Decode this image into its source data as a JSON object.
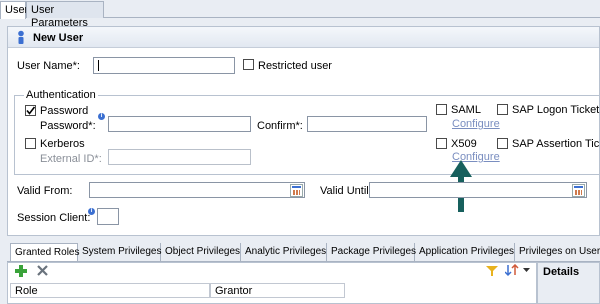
{
  "tabs": [
    {
      "label": "User"
    },
    {
      "label": "User Parameters"
    }
  ],
  "header": {
    "title": "New User"
  },
  "form": {
    "user_name_label": "User Name*:",
    "user_name_value": "",
    "restricted_user_label": "Restricted user",
    "authentication_label": "Authentication",
    "password_label": "Password",
    "password_field_label": "Password*:",
    "confirm_label": "Confirm*:",
    "kerberos_label": "Kerberos",
    "external_id_label": "External ID*:",
    "saml_label": "SAML",
    "saml_configure": "Configure",
    "x509_label": "X509",
    "x509_configure": "Configure",
    "sap_logon_ticket_label": "SAP Logon Ticket",
    "sap_assertion_ticket_label": "SAP Assertion Ticket",
    "valid_from_label": "Valid From:",
    "valid_until_label": "Valid Until:",
    "session_client_label": "Session Client:",
    "password_checked": true
  },
  "bottom_tabs": [
    {
      "label": "Granted Roles"
    },
    {
      "label": "System Privileges"
    },
    {
      "label": "Object Privileges"
    },
    {
      "label": "Analytic Privileges"
    },
    {
      "label": "Package Privileges"
    },
    {
      "label": "Application Privileges"
    },
    {
      "label": "Privileges on Users"
    }
  ],
  "table": {
    "columns": [
      "Role",
      "Grantor"
    ]
  },
  "details_label": "Details",
  "colors": {
    "arrow": "#17605d",
    "link": "#7a8ec0",
    "accent": "#3b6fd1"
  }
}
